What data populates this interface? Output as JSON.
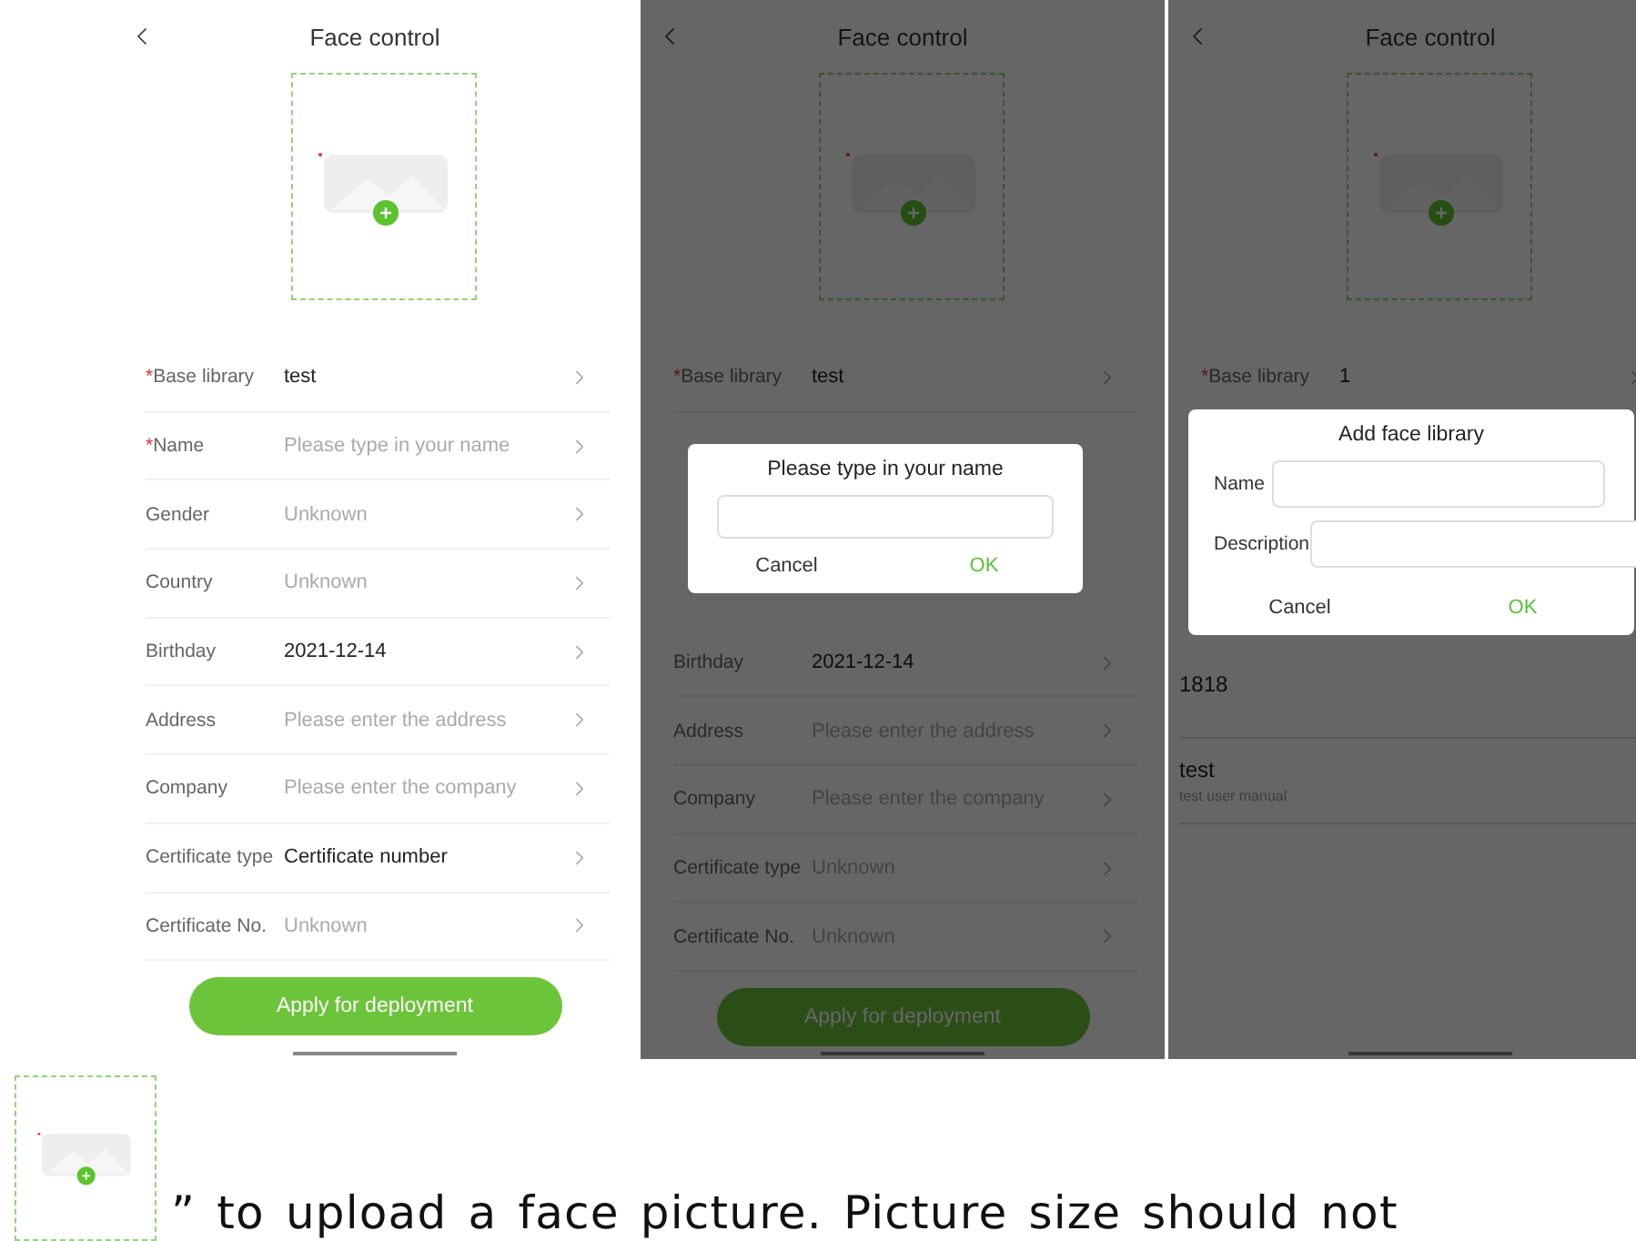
{
  "screens": [
    {
      "dimmed": false,
      "title": "Face control",
      "items": [
        {
          "kind": "row",
          "marker": "*",
          "label": "Base library",
          "value": "test",
          "muted": false
        },
        {
          "kind": "row",
          "marker": "*",
          "label": "Name",
          "placeholder": "Please type in your name"
        },
        {
          "kind": "row",
          "label": "Gender",
          "value": "Unknown",
          "muted": true
        },
        {
          "kind": "row",
          "label": "Country",
          "value": "Unknown",
          "muted": true
        },
        {
          "kind": "row",
          "label": "Birthday",
          "value": "2021-12-14",
          "muted": false
        },
        {
          "kind": "row",
          "label": "Address",
          "placeholder": "Please enter the address"
        },
        {
          "kind": "row",
          "label": "Company",
          "placeholder": "Please enter the company"
        },
        {
          "kind": "row",
          "label": "Certificate type",
          "value": "Certificate number",
          "muted": false
        },
        {
          "kind": "row",
          "label": "Certificate No.",
          "value": "Unknown",
          "muted": true
        },
        {
          "kind": "button",
          "label": "Apply for deployment"
        }
      ]
    },
    {
      "dimmed": true,
      "title": "Face control",
      "items": [
        {
          "kind": "row",
          "marker": "*",
          "label": "Base library",
          "value": "test",
          "muted": false
        },
        {
          "kind": "dialog",
          "title": "Please type in your name",
          "fields": [
            {
              "kind": "plain"
            }
          ],
          "buttons": [
            {
              "label": "Cancel",
              "primary": false
            },
            {
              "label": "OK",
              "primary": true
            }
          ]
        },
        {
          "kind": "row",
          "label": "Birthday",
          "value": "2021-12-14",
          "muted": false
        },
        {
          "kind": "row",
          "label": "Address",
          "placeholder": "Please enter the address"
        },
        {
          "kind": "row",
          "label": "Company",
          "placeholder": "Please enter the company"
        },
        {
          "kind": "row",
          "label": "Certificate type",
          "value": "Unknown",
          "muted": true
        },
        {
          "kind": "row",
          "label": "Certificate No.",
          "value": "Unknown",
          "muted": true
        },
        {
          "kind": "button",
          "label": "Apply for deployment"
        }
      ]
    },
    {
      "dimmed": true,
      "title": "Face control",
      "items": [
        {
          "kind": "row",
          "marker": "*",
          "label": "Base library",
          "value": "1",
          "muted": false
        },
        {
          "kind": "dialog",
          "title": "Add face library",
          "fields": [
            {
              "kind": "labeled",
              "label": "Name"
            },
            {
              "kind": "labeled",
              "label": "Description"
            }
          ],
          "buttons": [
            {
              "label": "Cancel",
              "primary": false
            },
            {
              "label": "OK",
              "primary": true
            }
          ]
        },
        {
          "kind": "list_item",
          "title": "1818"
        },
        {
          "kind": "list_item",
          "title": "test",
          "subtitle": "test user manual"
        }
      ]
    }
  ],
  "caption": "” to upload a face picture. Picture size should not"
}
